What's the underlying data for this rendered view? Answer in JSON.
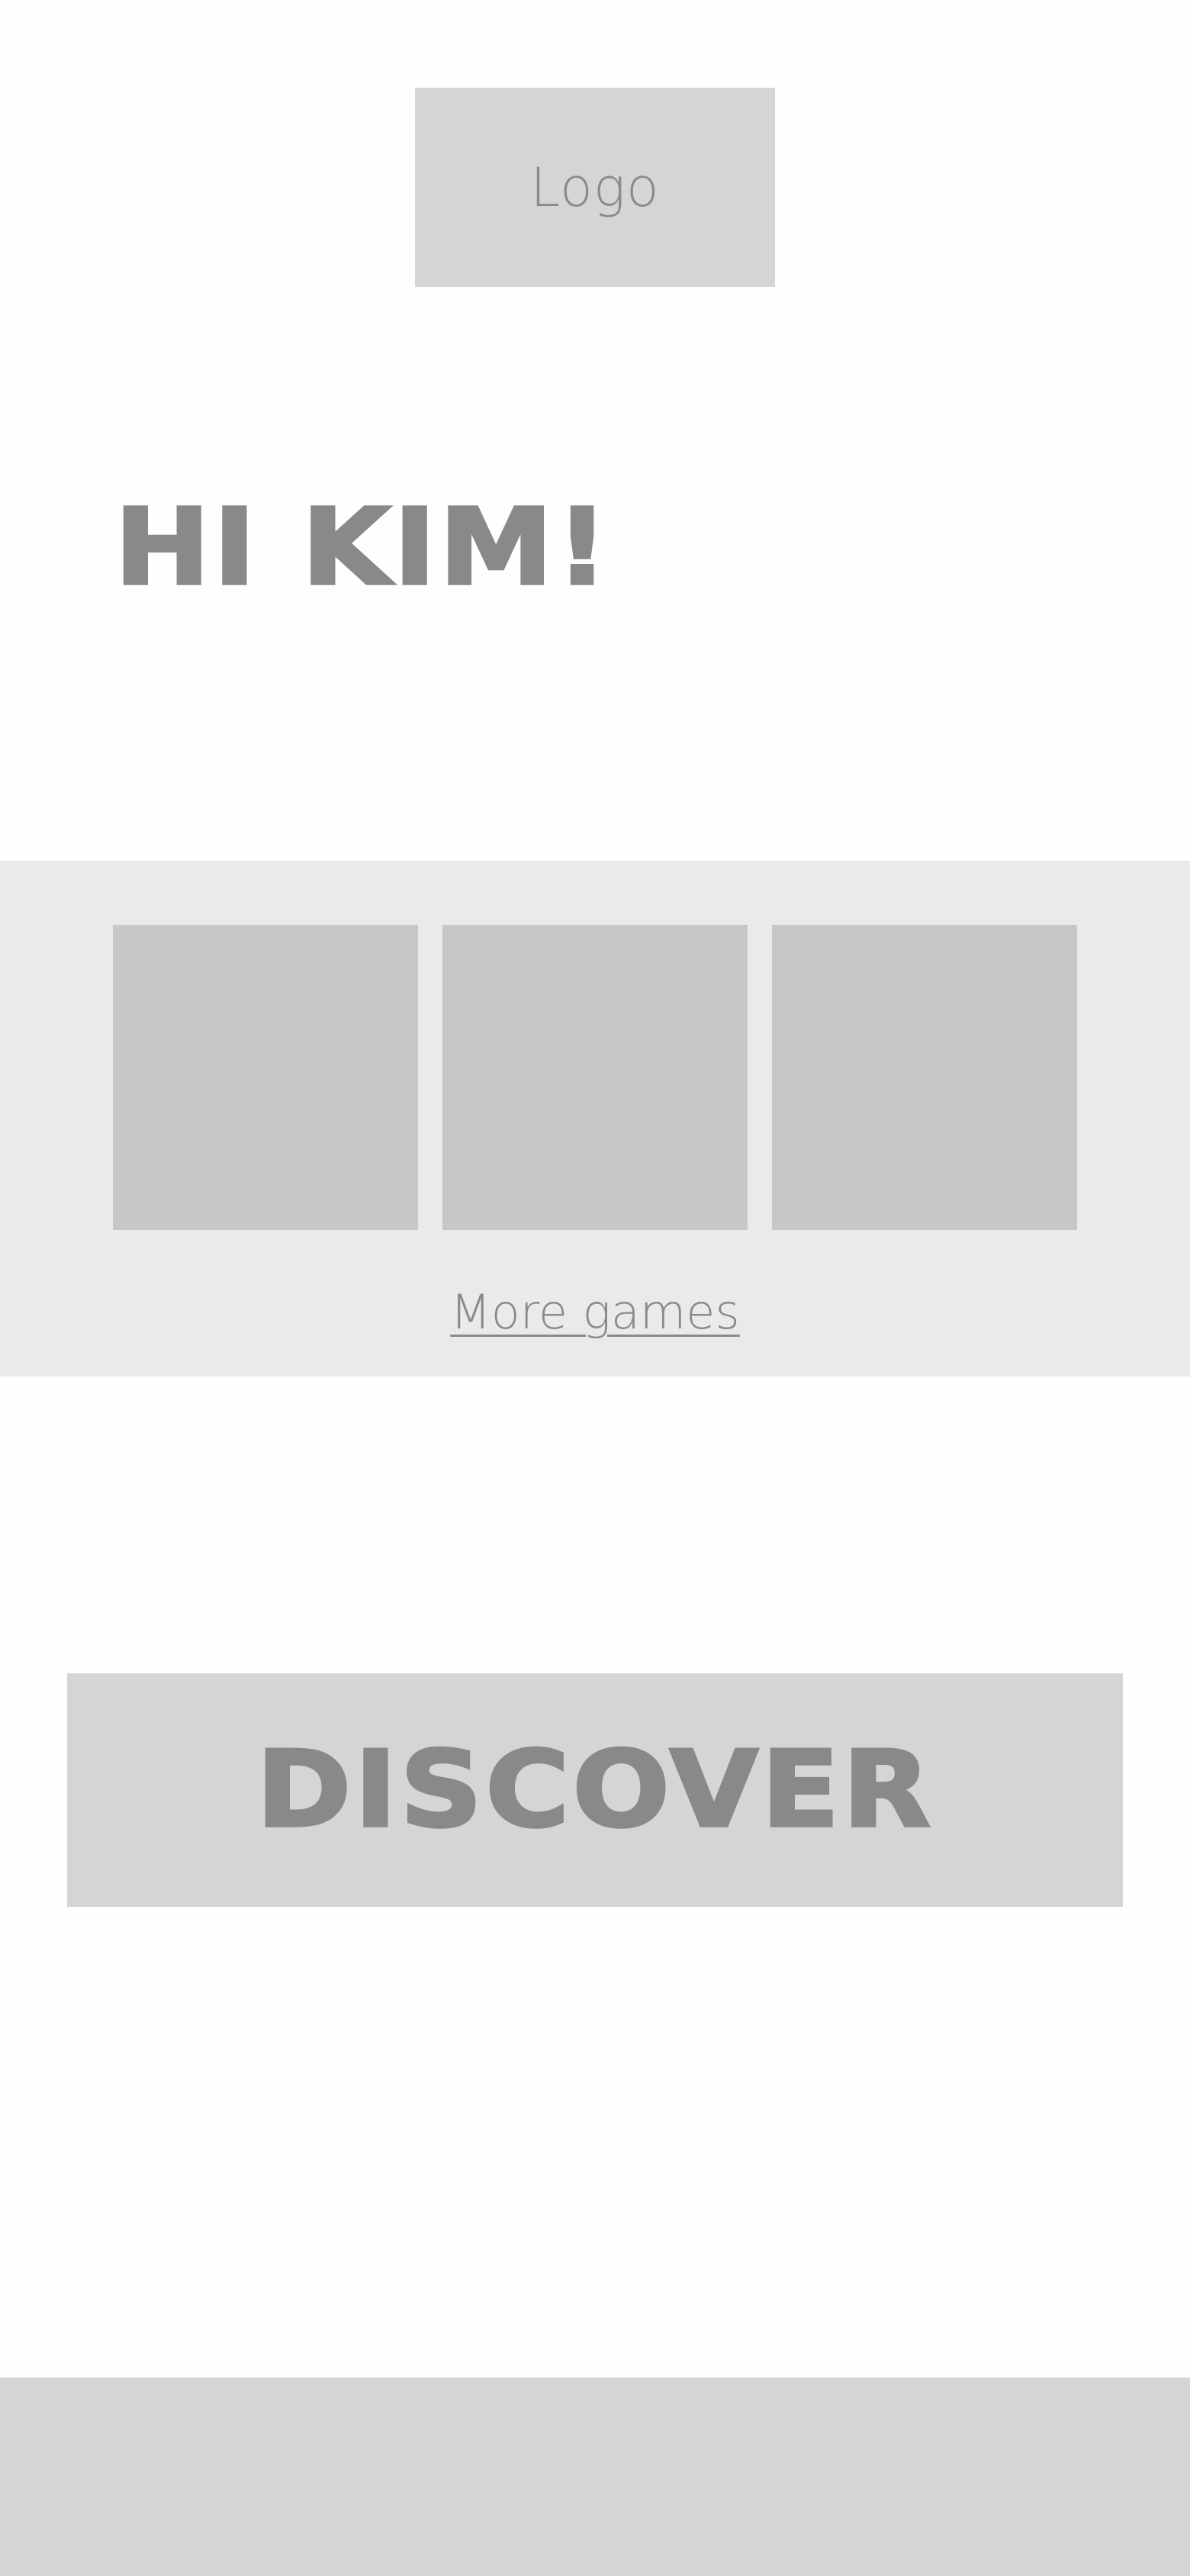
{
  "header": {
    "logo_text": "Logo"
  },
  "greeting": {
    "text": "HI KIM!"
  },
  "games": {
    "tiles": [
      {
        "label": ""
      },
      {
        "label": ""
      },
      {
        "label": ""
      }
    ],
    "more_label": "More games"
  },
  "discover": {
    "label": "DISCOVER"
  },
  "colors": {
    "placeholder": "#D5D5D5",
    "section_bg": "#EAEAEA",
    "tile": "#C7C7C7",
    "text": "#898989",
    "page_bg": "#FEFEFE"
  }
}
